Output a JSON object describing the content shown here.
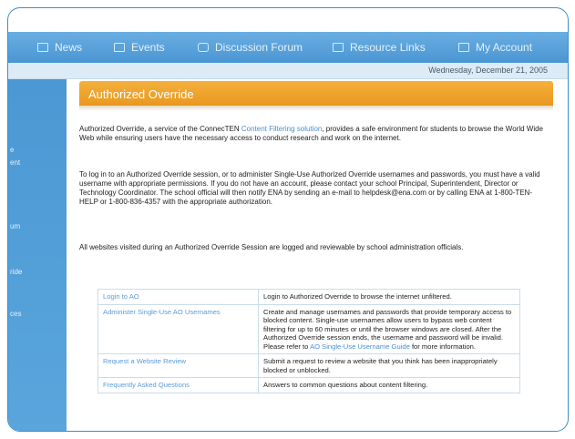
{
  "nav": {
    "items": [
      {
        "label": "News",
        "icon": "news-icon"
      },
      {
        "label": "Events",
        "icon": "events-icon"
      },
      {
        "label": "Discussion Forum",
        "icon": "discussion-forum-icon"
      },
      {
        "label": "Resource Links",
        "icon": "resource-links-icon"
      },
      {
        "label": "My Account",
        "icon": "my-account-icon"
      }
    ]
  },
  "date": "Wednesday, December 21, 2005",
  "sidebar": {
    "items": [
      "e",
      "ent",
      "um",
      "ride",
      "ces"
    ]
  },
  "page": {
    "title": "Authorized Override",
    "intro": {
      "pre": "Authorized Override, a service of the ConnecTEN ",
      "link": "Content Filtering solution",
      "post": ", provides a safe environment for students to browse the World Wide Web while ensuring users have the necessary access to conduct research and work on the internet."
    },
    "login_text": "To log in to an Authorized Override session, or to administer Single-Use Authorized Override usernames and passwords, you must have a valid username with appropriate permissions. If you do not have an account, please contact your school Principal, Superintendent, Director or Technology Coordinator. The school official will then notify ENA by sending an e-mail to helpdesk@ena.com or by calling ENA at 1-800-TEN-HELP or 1-800-836-4357 with the appropriate authorization.",
    "logged_text": "All websites visited during an Authorized Override Session are logged and reviewable by school administration officials."
  },
  "links_table": {
    "rows": [
      {
        "link": "Login to AO",
        "desc": "Login to Authorized Override to browse the internet unfiltered."
      },
      {
        "link": "Administer Single-Use AO Usernames",
        "desc_pre": "Create and manage usernames and passwords that provide temporary access to blocked content. Single-use usernames allow users to bypass web content filtering for up to 60 minutes or until the browser windows are closed. After the Authorized Override session ends, the username and password will be invalid. Please refer to ",
        "desc_link": "AO Single-Use Username Guide",
        "desc_post": " for more information."
      },
      {
        "link": "Request a Website Review",
        "desc": "Submit a request to review a website that you think has been inappropriately blocked or unblocked."
      },
      {
        "link": "Frequently Asked Questions",
        "desc": "Answers to common questions about content filtering."
      }
    ]
  },
  "colors": {
    "nav_blue": "#4a96d3",
    "header_orange": "#f0a52e",
    "link_blue": "#4a8fd1"
  }
}
